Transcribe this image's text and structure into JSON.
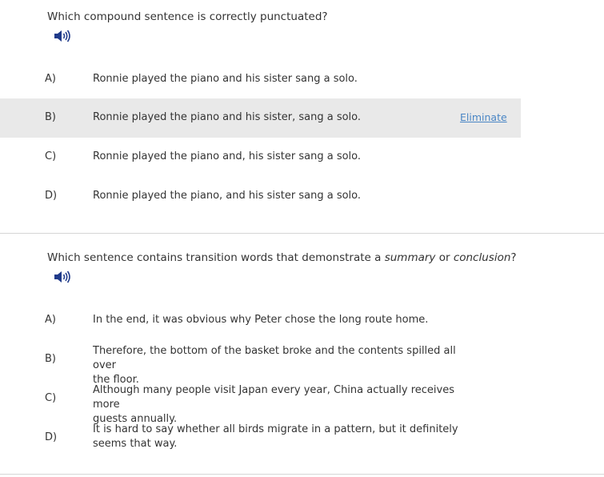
{
  "question1": {
    "prompt": "Which compound sentence is correctly punctuated?",
    "audio_icon": "speaker-icon",
    "options": [
      {
        "letter": "A)",
        "text": "Ronnie played the piano and his sister sang a solo."
      },
      {
        "letter": "B)",
        "text": "Ronnie played the piano and his sister, sang a solo.",
        "action": "Eliminate"
      },
      {
        "letter": "C)",
        "text": "Ronnie played the piano and, his sister sang a solo."
      },
      {
        "letter": "D)",
        "text": "Ronnie played the piano, and his sister sang a solo."
      }
    ]
  },
  "question2": {
    "prompt_pre": "Which sentence contains transition words that demonstrate a ",
    "prompt_em1": "summary",
    "prompt_mid": " or ",
    "prompt_em2": "conclusion",
    "prompt_post": "?",
    "audio_icon": "speaker-icon",
    "options": [
      {
        "letter": "A)",
        "line1": "In the end, it was obvious why Peter chose the long route home.",
        "line2": ""
      },
      {
        "letter": "B)",
        "line1": "Therefore, the bottom of the basket broke and the contents spilled all over",
        "line2": "the floor."
      },
      {
        "letter": "C)",
        "line1": "Although many people visit Japan every year, China actually receives more",
        "line2": "guests annually."
      },
      {
        "letter": "D)",
        "line1": "It is hard to say whether all birds migrate in a pattern, but it definitely",
        "line2": "seems that way."
      }
    ]
  },
  "colors": {
    "text": "#333333",
    "hover_row": "#e9e9e9",
    "link": "#4a86c5",
    "divider": "#d6d6d6",
    "icon": "#1f3a8a"
  }
}
